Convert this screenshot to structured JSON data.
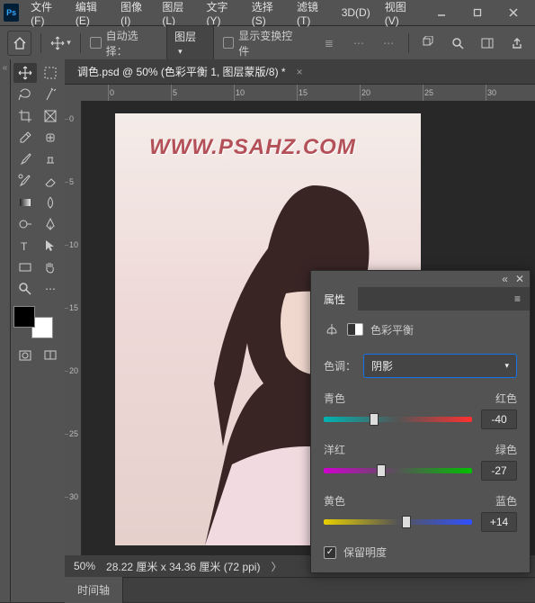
{
  "menu": [
    "文件(F)",
    "编辑(E)",
    "图像(I)",
    "图层(L)",
    "文字(Y)",
    "选择(S)",
    "滤镜(T)",
    "3D(D)",
    "视图(V)"
  ],
  "options": {
    "auto_select": "自动选择：",
    "target": "图层",
    "show_transform": "显示变换控件"
  },
  "document": {
    "tab_title": "调色.psd @ 50% (色彩平衡 1, 图层蒙版/8) *",
    "watermark": "WWW.PSAHZ.COM"
  },
  "status": {
    "zoom": "50%",
    "dims": "28.22 厘米 x 34.36 厘米 (72 ppi)"
  },
  "timeline": {
    "tab": "时间轴"
  },
  "panel": {
    "title": "属性",
    "adj_name": "色彩平衡",
    "tone_label": "色调：",
    "tone_value": "阴影",
    "sliders": [
      {
        "left": "青色",
        "right": "红色",
        "value": "-40",
        "pos": 34
      },
      {
        "left": "洋红",
        "right": "绿色",
        "value": "-27",
        "pos": 39
      },
      {
        "left": "黄色",
        "right": "蓝色",
        "value": "+14",
        "pos": 56
      }
    ],
    "preserve": "保留明度"
  },
  "ruler_marks": [
    0,
    5,
    10,
    15,
    20,
    25,
    30
  ]
}
